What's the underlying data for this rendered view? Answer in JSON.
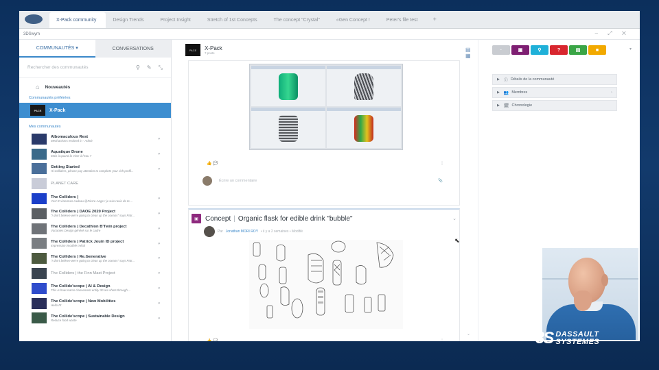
{
  "browser": {
    "tabs": [
      {
        "label": "X-Pack community",
        "active": true
      },
      {
        "label": "Design Trends",
        "active": false
      },
      {
        "label": "Project Insight",
        "active": false
      },
      {
        "label": "Stretch of 1st Concepts",
        "active": false
      },
      {
        "label": "The concept \"Crystal\"",
        "active": false
      },
      {
        "label": "«Gen Concept !",
        "active": false
      },
      {
        "label": "Peter's file test",
        "active": false
      }
    ],
    "new_tab": "+",
    "app_name": "3DSwym",
    "window_controls": "‒ ⤢ ✕"
  },
  "left_panel": {
    "tab_communities": "COMMUNAUTÉS ▾",
    "tab_conversations": "CONVERSATIONS",
    "search_placeholder": "Rechercher des communautés",
    "news_label": "Nouveautés",
    "favorites_label": "Communautés préférées",
    "favorite": {
      "name": "X-Pack",
      "thumb_text": "PACE"
    },
    "my_communities_label": "Mes communautés",
    "communities": [
      {
        "title": "Albomaculous Rest",
        "subtitle": "Mechanisms evolved in - Admit",
        "pin": "▾",
        "thumb": "#2a3a6a"
      },
      {
        "title": "Aquatique Drone",
        "subtitle": "Mais à quand la mise à l'eau ?",
        "pin": "▾",
        "thumb": "#3a6a8a"
      },
      {
        "title": "Getting Started",
        "subtitle": "Hi Colliders, please pay attention to complete your rich profil...",
        "pin": "▾",
        "thumb": "#4a6f9a"
      },
      {
        "title": "PLANET CARE",
        "subtitle": "",
        "pin": "",
        "thumb": "#c9ccd8"
      },
      {
        "title": "The Colliders |",
        "subtitle": "Yes! Et énormes cadeau @Pierre-Ange ! je suis ravie de te ...",
        "pin": "▾",
        "thumb": "#1b3fc9"
      },
      {
        "title": "The Colliders | DAOE 2020 Project",
        "subtitle": "\"I don't believe we're going to clean up the oceans\" says Patr...",
        "pin": "▾",
        "thumb": "#5b5f63"
      },
      {
        "title": "The Colliders | Decathlon B'Twin project",
        "subtitle": "Variantes Design généré sur le cadre",
        "pin": "▾",
        "thumb": "#6f7378"
      },
      {
        "title": "The Colliders | Patrick Jouin ID project",
        "subtitle": "Impression imodèle métal",
        "pin": "▾",
        "thumb": "#7a7e82"
      },
      {
        "title": "The Colliders | Re.Generative",
        "subtitle": "\"I don't believe we're going to clean up the oceans\" says Patr...",
        "pin": "▾",
        "thumb": "#4d5a3f"
      },
      {
        "title": "The Colliders | the Finn Mast Project",
        "subtitle": "",
        "pin": "▾",
        "thumb": "#3a4450"
      },
      {
        "title": "The Collide'scope | AI & Design",
        "subtitle": "This is how teams classement entity 30 are shots through ...",
        "pin": "▾",
        "thumb": "#2f4ccc"
      },
      {
        "title": "The Collide'scope | New Mobilities",
        "subtitle": "Hello Pt",
        "pin": "▾",
        "thumb": "#2a2f5a"
      },
      {
        "title": "The Collide'scope | Sustainable Design",
        "subtitle": "Reduce food waste",
        "pin": "▾",
        "thumb": "#3a5a48"
      }
    ]
  },
  "feed": {
    "community_name": "X-Pack",
    "community_meta": "7 posts",
    "logo_text": "PACE",
    "view_icons": "▤ ▦",
    "post1": {
      "actions_left": "👍   💬",
      "actions_right": "⋮",
      "comment_placeholder": "Écrire un commentaire",
      "attach_icon": "📎"
    },
    "post2": {
      "type": "Concept",
      "separator": "|",
      "title": "Organic flask for edible drink \"bubble\"",
      "by": "Par",
      "author": "Jonathan MORI ROY",
      "meta": "• il y a 2 semaines • Modifié",
      "menu": "⌄",
      "actions_left": "👍   💬",
      "actions_right": "⋮"
    },
    "scroll_icon": "⌄"
  },
  "right_panel": {
    "apps": [
      {
        "icon": "·",
        "color": "#c9ccd1"
      },
      {
        "icon": "▣",
        "color": "#7e1f72"
      },
      {
        "icon": "⚲",
        "color": "#1fb0d8"
      },
      {
        "icon": "?",
        "color": "#d8262e"
      },
      {
        "icon": "▤",
        "color": "#3aa546"
      },
      {
        "icon": "■",
        "color": "#f2a900"
      }
    ],
    "apps_chevron": "▾",
    "accordions": [
      {
        "label": "Détails de la communauté",
        "icon": "ⓘ",
        "more": ""
      },
      {
        "label": "Membres",
        "icon": "👥",
        "more": "›"
      },
      {
        "label": "Chronologie",
        "icon": "🗓",
        "more": ""
      }
    ]
  },
  "branding": {
    "mark": "3S",
    "line1": "DASSAULT",
    "line2": "SYSTEMES"
  }
}
